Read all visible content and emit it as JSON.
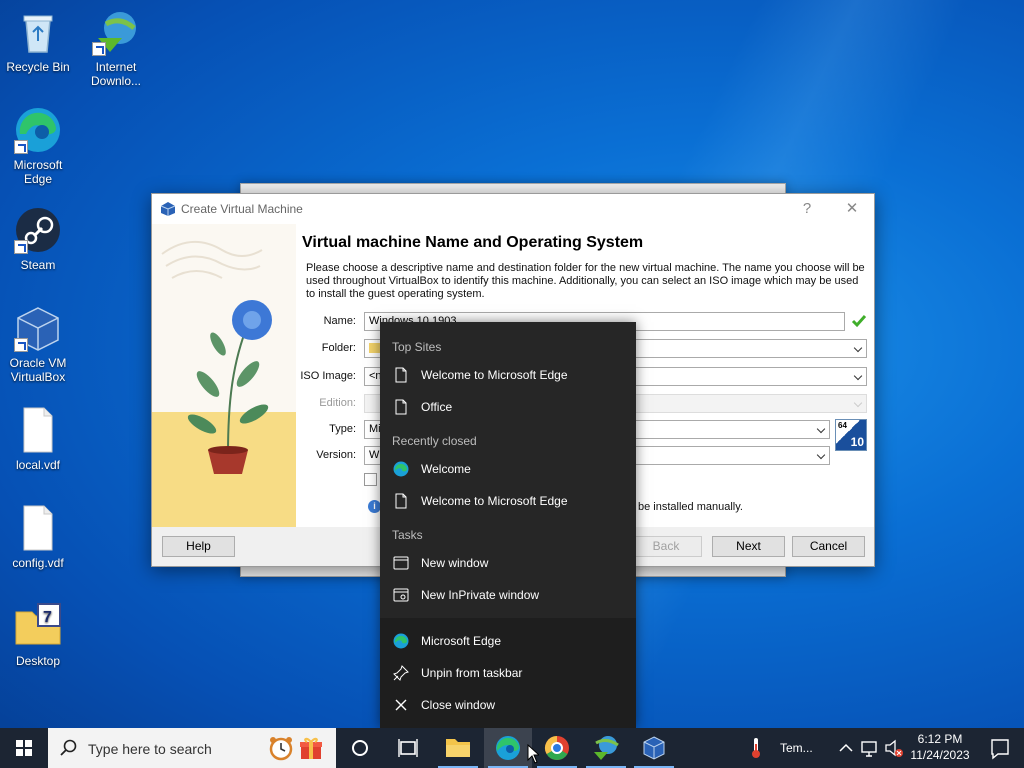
{
  "desktop": {
    "icons": [
      {
        "label": "Recycle Bin"
      },
      {
        "label": "Internet Downlo..."
      },
      {
        "label": "Microsoft Edge"
      },
      {
        "label": "Steam"
      },
      {
        "label": "Oracle VM VirtualBox"
      },
      {
        "label": "local.vdf"
      },
      {
        "label": "config.vdf"
      },
      {
        "label": "Desktop"
      }
    ]
  },
  "dialog": {
    "title": "Create Virtual Machine",
    "help_glyph": "?",
    "close_glyph": "✕",
    "heading": "Virtual machine Name and Operating System",
    "description": "Please choose a descriptive name and destination folder for the new virtual machine. The name you choose will be used throughout VirtualBox to identify this machine. Additionally, you can select an ISO image which may be used to install the guest operating system.",
    "labels": {
      "name": "Name:",
      "folder": "Folder:",
      "iso": "ISO Image:",
      "edition": "Edition:",
      "type": "Type:",
      "version": "Version:"
    },
    "values": {
      "name": "Windows 10 1903",
      "iso": "<n",
      "type": "Mi",
      "version": "Wi"
    },
    "partial_note": "be installed manually.",
    "os_badge": {
      "top": "64",
      "bottom": "10"
    },
    "buttons": {
      "help": "Help",
      "back": "Back",
      "next": "Next",
      "cancel": "Cancel"
    }
  },
  "jumplist": {
    "sections": {
      "top_sites": "Top Sites",
      "recently_closed": "Recently closed",
      "tasks": "Tasks"
    },
    "top_sites": [
      "Welcome to Microsoft Edge",
      "Office"
    ],
    "recently_closed": [
      "Welcome",
      "Welcome to Microsoft Edge"
    ],
    "tasks": [
      "New window",
      "New InPrivate window"
    ],
    "app_actions": [
      "Microsoft Edge",
      "Unpin from taskbar",
      "Close window"
    ]
  },
  "taskbar": {
    "search_placeholder": "Type here to search",
    "weather": "Tem...",
    "time": "6:12 PM",
    "date": "11/24/2023"
  },
  "colors": {
    "accent": "#0078d4",
    "taskbar": "#1c2533",
    "jumplist": "#262626"
  }
}
